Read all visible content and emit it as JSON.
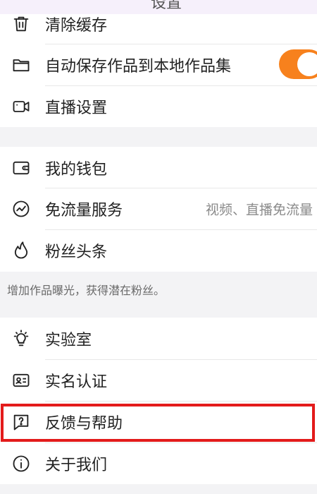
{
  "header": {
    "title_fragment": "设置"
  },
  "section1": {
    "items": [
      {
        "label": "清除缓存",
        "icon": "trash-icon"
      },
      {
        "label": "自动保存作品到本地作品集",
        "icon": "folder-icon",
        "toggle_on": true,
        "toggle_color": "#f7811d"
      },
      {
        "label": "直播设置",
        "icon": "video-camera-icon"
      }
    ]
  },
  "section2": {
    "items": [
      {
        "label": "我的钱包",
        "icon": "wallet-icon"
      },
      {
        "label": "免流量服务",
        "icon": "trend-circle-icon",
        "value": "视频、直播免流量"
      },
      {
        "label": "粉丝头条",
        "icon": "flame-icon"
      }
    ],
    "note": "增加作品曝光，获得潜在粉丝。"
  },
  "section3": {
    "items": [
      {
        "label": "实验室",
        "icon": "lightbulb-icon"
      },
      {
        "label": "实名认证",
        "icon": "id-card-icon"
      },
      {
        "label": "反馈与帮助",
        "icon": "help-chat-icon",
        "highlighted": true,
        "highlight_color": "#e31b1b"
      },
      {
        "label": "关于我们",
        "icon": "info-icon"
      }
    ]
  }
}
